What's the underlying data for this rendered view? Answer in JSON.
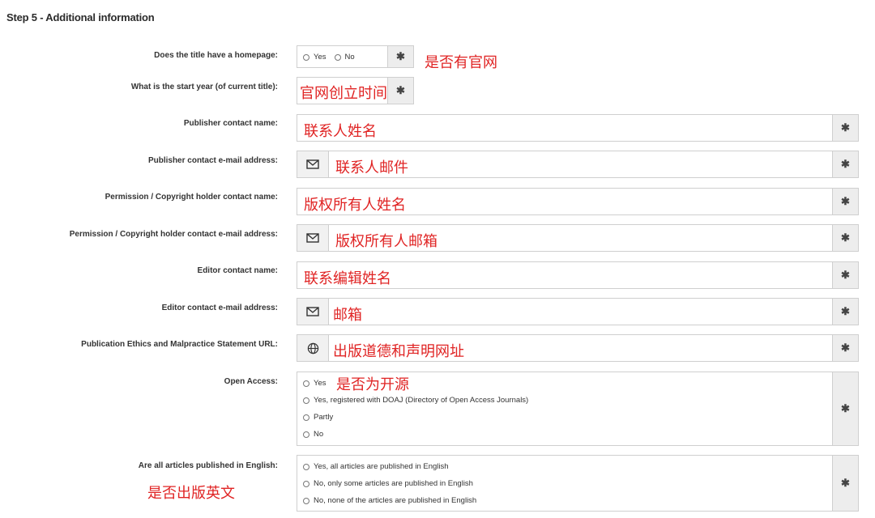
{
  "step_title": "Step 5 - Additional information",
  "fields": {
    "homepage": {
      "label": "Does the title have a homepage:",
      "options": [
        "Yes",
        "No"
      ],
      "annotation": "是否有官网"
    },
    "start_year": {
      "label": "What is the start year (of current title):",
      "annotation": "官网创立时间"
    },
    "publisher_name": {
      "label": "Publisher contact name:",
      "annotation": "联系人姓名"
    },
    "publisher_email": {
      "label": "Publisher contact e-mail address:",
      "annotation": "联系人邮件"
    },
    "copyright_name": {
      "label": "Permission / Copyright holder contact name:",
      "annotation": "版权所有人姓名"
    },
    "copyright_email": {
      "label": "Permission / Copyright holder contact e-mail address:",
      "annotation": "版权所有人邮箱"
    },
    "editor_name": {
      "label": "Editor contact name:",
      "annotation": "联系编辑姓名"
    },
    "editor_email": {
      "label": "Editor contact e-mail address:",
      "annotation": "邮箱"
    },
    "ethics_url": {
      "label": "Publication Ethics and Malpractice Statement URL:",
      "annotation": "出版道德和声明网址"
    },
    "open_access": {
      "label": "Open Access:",
      "options": [
        "Yes",
        "Yes, registered with DOAJ (Directory of Open Access Journals)",
        "Partly",
        "No"
      ],
      "annotation": "是否为开源"
    },
    "english": {
      "label": "Are all articles published in English:",
      "options": [
        "Yes, all articles are published in English",
        "No, only some articles are published in English",
        "No, none of the articles are published in English"
      ],
      "annotation": "是否出版英文"
    }
  },
  "required_marker": "✱",
  "icons": {
    "email": "envelope-icon",
    "url": "globe-icon"
  },
  "colors": {
    "annotation": "#e02424",
    "addon_bg": "#ededed",
    "border": "#cfcfcf"
  }
}
